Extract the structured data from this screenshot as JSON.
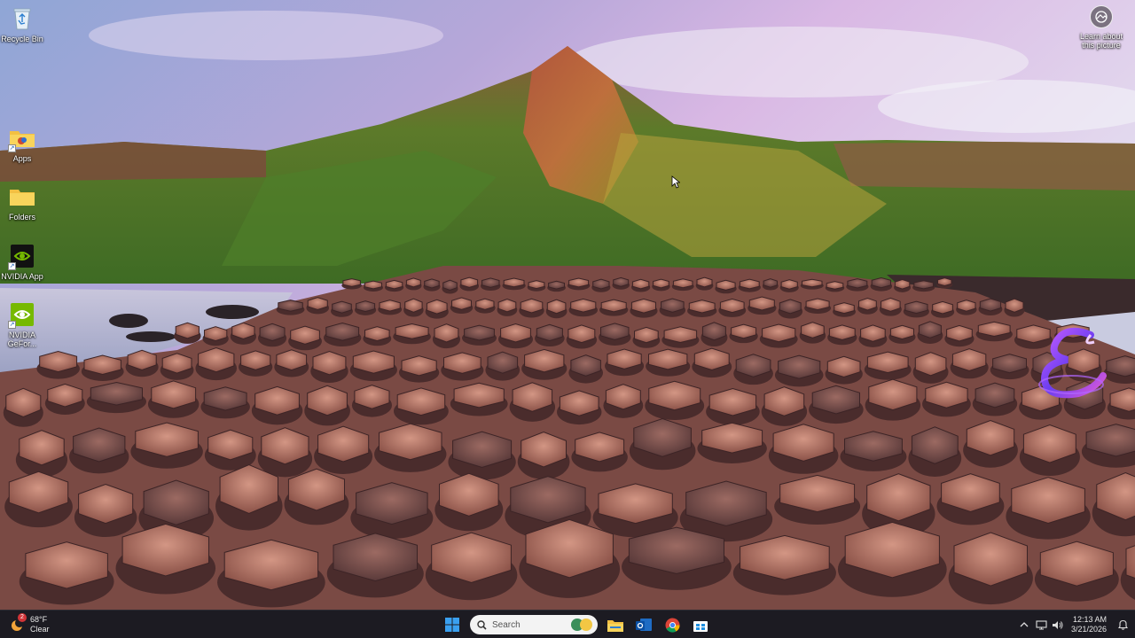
{
  "desktop": {
    "icons": [
      {
        "label": "Recycle Bin",
        "icon": "recycle-bin-icon"
      },
      {
        "label": "Apps",
        "icon": "folder-icon"
      },
      {
        "label": "Folders",
        "icon": "folder-icon"
      },
      {
        "label": "NVIDIA App",
        "icon": "nvidia-icon"
      },
      {
        "label": "NVIDIA GeFor...",
        "icon": "nvidia-icon"
      }
    ],
    "learn_about": {
      "label": "Learn about this picture",
      "icon": "camera-icon"
    }
  },
  "taskbar": {
    "weather": {
      "temp": "68°F",
      "condition": "Clear",
      "badge": "2"
    },
    "search_label": "Search",
    "apps": [
      "start-icon",
      "search-icon",
      "file-explorer-icon",
      "outlook-icon",
      "chrome-icon",
      "store-icon"
    ],
    "tray": [
      "chevron-up-icon",
      "network-icon",
      "volume-icon",
      "notification-icon"
    ],
    "clock": {
      "time": "12:13 AM",
      "date": "3/21/2026"
    }
  },
  "colors": {
    "taskbar_bg": "#1c1b22",
    "accent_blue": "#0078d4"
  }
}
